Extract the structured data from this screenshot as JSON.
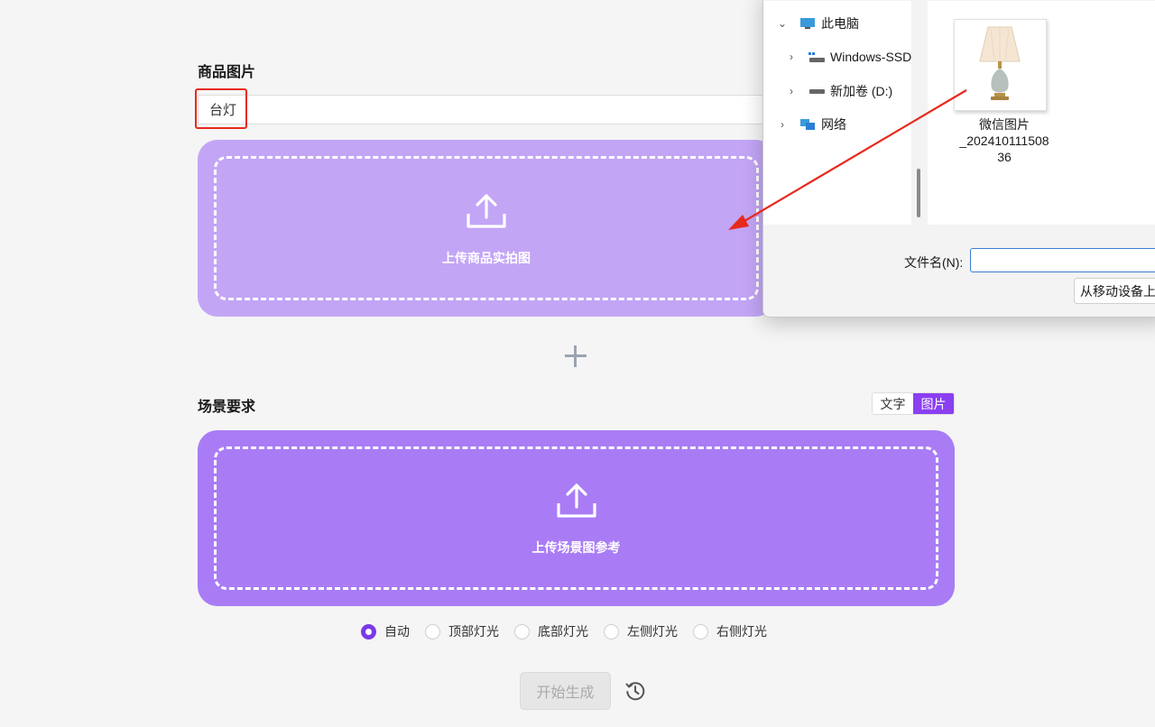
{
  "product": {
    "title": "商品图片",
    "input_value": "台灯",
    "upload_label": "上传商品实拍图"
  },
  "scene": {
    "title": "场景要求",
    "toggle": [
      "文字",
      "图片"
    ],
    "active_toggle": "图片",
    "upload_label": "上传场景图参考"
  },
  "lighting": {
    "options": [
      "自动",
      "顶部灯光",
      "底部灯光",
      "左侧灯光",
      "右侧灯光"
    ],
    "selected": "自动"
  },
  "actions": {
    "start_label": "开始生成",
    "history_icon": "history-clock-icon"
  },
  "dialog": {
    "nav": [
      {
        "label": "此电脑",
        "icon": "monitor-icon",
        "expanded": true
      },
      {
        "label": "Windows-SSD",
        "icon": "drive-icon",
        "expanded": false
      },
      {
        "label": "新加卷 (D:)",
        "icon": "drive-icon",
        "expanded": false
      },
      {
        "label": "网络",
        "icon": "network-icon",
        "expanded": false
      }
    ],
    "file": {
      "name_line1": "微信图片",
      "name_line2": "_202410111508",
      "name_line3": "36"
    },
    "filename_label": "文件名(N):",
    "filename_value": "",
    "mobile_button": "从移动设备上"
  },
  "colors": {
    "accent": "#8a3ff1",
    "upload_light": "#c3a5f6",
    "upload_dark": "#a97cf5",
    "annotation_red": "#e8291c"
  }
}
